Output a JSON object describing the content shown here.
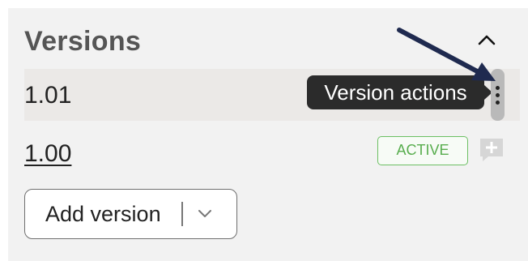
{
  "panel": {
    "title": "Versions",
    "collapse_icon": "chevron-up-icon"
  },
  "versions": [
    {
      "label": "1.01",
      "hovered": true
    },
    {
      "label": "1.00",
      "status_badge": "ACTIVE"
    }
  ],
  "tooltip": {
    "text": "Version actions"
  },
  "icons": {
    "actions": "vertical-ellipsis-icon",
    "comment": "add-comment-icon",
    "add_dropdown": "chevron-down-icon",
    "annotation": "arrow-annotation"
  },
  "add_version": {
    "label": "Add version"
  },
  "colors": {
    "panel_bg": "#f2f2f2",
    "hover_row_bg": "#ebe9e7",
    "active_green": "#58ad4e",
    "tooltip_bg": "#2b2b2b",
    "annotation_arrow": "#1f2a4f"
  }
}
